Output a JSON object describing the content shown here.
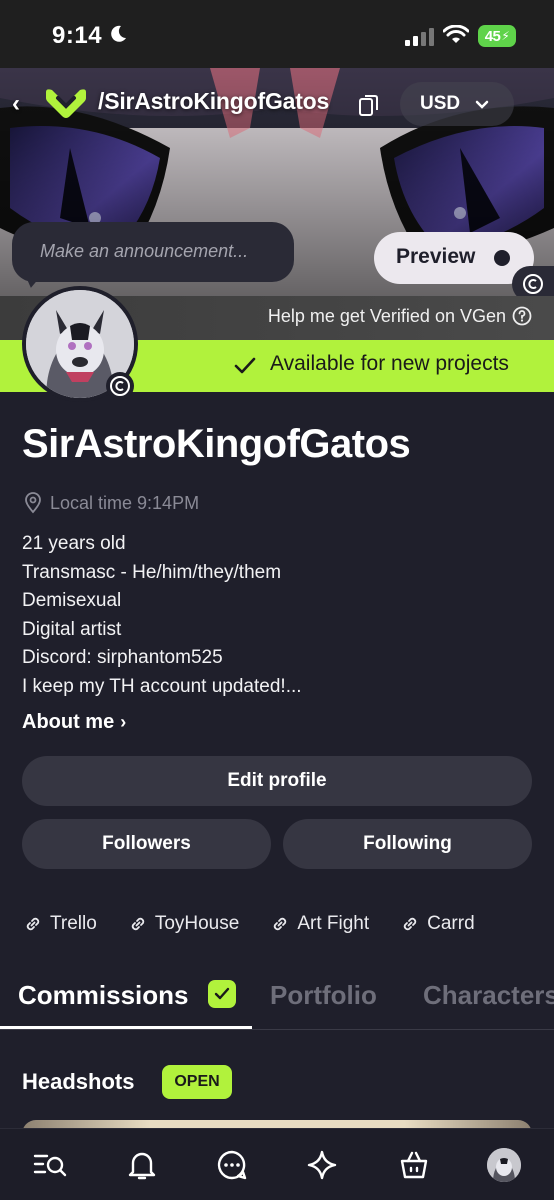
{
  "status_bar": {
    "time": "9:14",
    "battery": "45"
  },
  "header": {
    "handle": "/SirAstroKingofGatos",
    "currency": "USD"
  },
  "announcement": {
    "placeholder": "Make an announcement..."
  },
  "preview_label": "Preview",
  "verify_text": "Help me get Verified on VGen",
  "availability": "Available for new projects",
  "profile": {
    "name": "SirAstroKingofGatos",
    "local_time": "Local time 9:14PM",
    "bio": [
      "21 years old",
      "Transmasc - He/him/they/them",
      "Demisexual",
      "Digital artist",
      "Discord: sirphantom525",
      "I keep my TH account updated!..."
    ],
    "about_label": "About me"
  },
  "buttons": {
    "edit": "Edit profile",
    "followers": "Followers",
    "following": "Following"
  },
  "links": [
    "Trello",
    "ToyHouse",
    "Art Fight",
    "Carrd"
  ],
  "tabs": [
    "Commissions",
    "Portfolio",
    "Characters"
  ],
  "section": {
    "title": "Headshots",
    "badge": "OPEN"
  },
  "colors": {
    "accent": "#b1f23c",
    "background": "#1f1f2b",
    "button": "#363642"
  },
  "nav": [
    "search-menu-icon",
    "bell-icon",
    "chat-icon",
    "sparkle-icon",
    "shopping-bag-icon",
    "profile-avatar"
  ]
}
